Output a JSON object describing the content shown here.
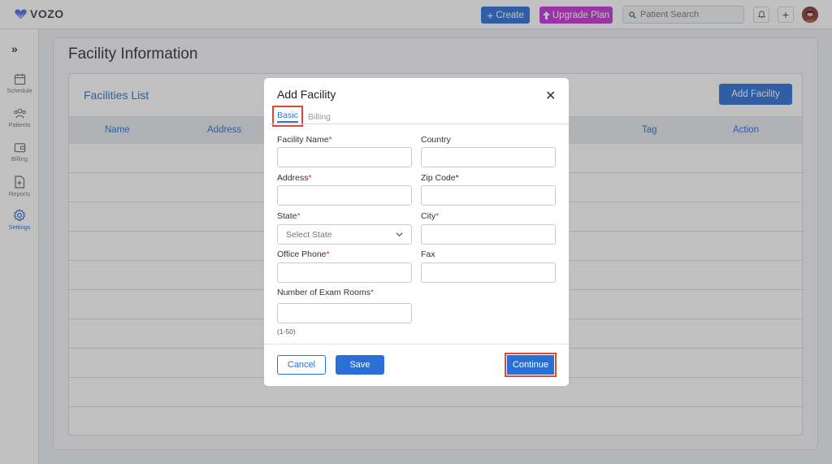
{
  "app": {
    "brand": "VOZO"
  },
  "topbar": {
    "create_label": "Create",
    "upgrade_label": "Upgrade Plan",
    "search_placeholder": "Patient Search",
    "notification_icon": "bell-icon",
    "add_icon": "plus-icon"
  },
  "sidebar": {
    "expand_icon": "double-chevron-right-icon",
    "items": [
      {
        "label": "Schedule",
        "icon": "calendar-icon"
      },
      {
        "label": "Patients",
        "icon": "users-icon"
      },
      {
        "label": "Billing",
        "icon": "wallet-icon"
      },
      {
        "label": "Reports",
        "icon": "report-icon"
      },
      {
        "label": "Settings",
        "icon": "gear-icon",
        "active": true
      }
    ]
  },
  "page": {
    "title": "Facility Information",
    "list_title": "Facilities List",
    "add_button": "Add Facility",
    "columns": [
      "Name",
      "Address",
      "Tag",
      "Action"
    ]
  },
  "modal": {
    "title": "Add Facility",
    "tabs": [
      {
        "label": "Basic",
        "active": true
      },
      {
        "label": "Billing",
        "active": false
      }
    ],
    "fields": {
      "facility_name": {
        "label": "Facility Name",
        "required": "*",
        "value": ""
      },
      "country": {
        "label": "Country",
        "value": ""
      },
      "address": {
        "label": "Address",
        "required": "*",
        "value": ""
      },
      "zip_code": {
        "label": "Zip  Code*",
        "value": ""
      },
      "state": {
        "label": "State",
        "required": "*",
        "placeholder": "Select State"
      },
      "city": {
        "label": "City",
        "required": "*",
        "value": ""
      },
      "office_phone": {
        "label": "Office Phone",
        "required": "*",
        "value": ""
      },
      "fax": {
        "label": "Fax",
        "value": ""
      },
      "exam_rooms": {
        "label": "Number of Exam Rooms",
        "required": "*",
        "value": "",
        "hint": "(1-50)"
      }
    },
    "cancel_label": "Cancel",
    "save_label": "Save",
    "continue_label": "Continue"
  },
  "colors": {
    "primary": "#2a6fd6",
    "upgrade": "#c531d8",
    "highlight": "#e0492e",
    "required": "#d9304a"
  }
}
